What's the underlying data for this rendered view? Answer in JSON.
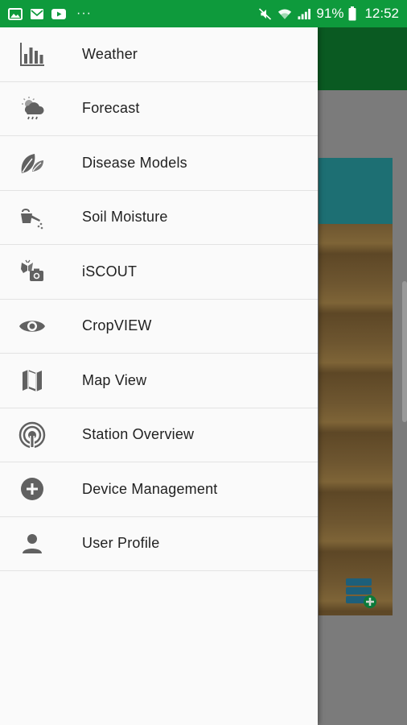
{
  "status_bar": {
    "left_icons": [
      "gallery-icon",
      "email-icon",
      "youtube-icon"
    ],
    "more": "···",
    "battery": "91%",
    "time": "12:52",
    "right_icons": [
      "mute-icon",
      "wifi-icon",
      "signal-icon",
      "battery-icon"
    ]
  },
  "drawer": {
    "items": [
      {
        "label": "Weather",
        "icon": "bar-chart-icon"
      },
      {
        "label": "Forecast",
        "icon": "weather-cloud-icon"
      },
      {
        "label": "Disease Models",
        "icon": "leaves-icon"
      },
      {
        "label": "Soil Moisture",
        "icon": "watering-can-icon"
      },
      {
        "label": "iSCOUT",
        "icon": "bug-camera-icon"
      },
      {
        "label": "CropVIEW",
        "icon": "eye-icon"
      },
      {
        "label": "Map View",
        "icon": "map-icon"
      },
      {
        "label": "Station Overview",
        "icon": "broadcast-icon"
      },
      {
        "label": "Device Management",
        "icon": "add-circle-icon"
      },
      {
        "label": "User Profile",
        "icon": "person-icon"
      }
    ]
  },
  "colors": {
    "status_bar": "#0e9a3c",
    "toolbar": "#0a5a22",
    "icon": "#616161",
    "text": "#212121"
  }
}
